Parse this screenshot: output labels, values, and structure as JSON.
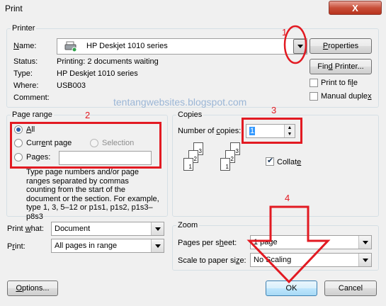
{
  "window": {
    "title": "Print",
    "close_label": "X"
  },
  "printer": {
    "group_label": "Printer",
    "name_label": "Name:",
    "name_value": "HP Deskjet 1010 series",
    "status_label": "Status:",
    "status_value": "Printing: 2 documents waiting",
    "type_label": "Type:",
    "type_value": "HP Deskjet 1010 series",
    "where_label": "Where:",
    "where_value": "USB003",
    "comment_label": "Comment:",
    "comment_value": "",
    "properties_label": "Properties",
    "find_printer_label": "Find Printer...",
    "print_to_file_label": "Print to file",
    "manual_duplex_label": "Manual duplex",
    "print_to_file_checked": false,
    "manual_duplex_checked": false
  },
  "watermark": "tentangwebsites.blogspot.com",
  "page_range": {
    "group_label": "Page range",
    "all_label": "All",
    "current_page_label": "Current page",
    "selection_label": "Selection",
    "pages_label": "Pages:",
    "pages_value": "",
    "selected": "All",
    "help_text": "Type page numbers and/or page ranges separated by commas counting from the start of the document or the section. For example, type 1, 3, 5–12 or p1s1, p1s2, p1s3–p8s3"
  },
  "copies": {
    "group_label": "Copies",
    "number_label": "Number of copies:",
    "number_value": "1",
    "collate_label": "Collate",
    "collate_checked": true,
    "page_numbers": [
      "3",
      "2",
      "1",
      "3",
      "2",
      "1"
    ]
  },
  "print_what": {
    "label": "Print what:",
    "value": "Document"
  },
  "print": {
    "label": "Print:",
    "value": "All pages in range"
  },
  "zoom": {
    "group_label": "Zoom",
    "pages_per_sheet_label": "Pages per sheet:",
    "pages_per_sheet_value": "1 page",
    "scale_label": "Scale to paper size:",
    "scale_value": "No Scaling"
  },
  "buttons": {
    "options_label": "Options...",
    "ok_label": "OK",
    "cancel_label": "Cancel"
  },
  "annotations": {
    "num1": "1",
    "num2": "2",
    "num3": "3",
    "num4": "4",
    "color": "#e21a22"
  }
}
